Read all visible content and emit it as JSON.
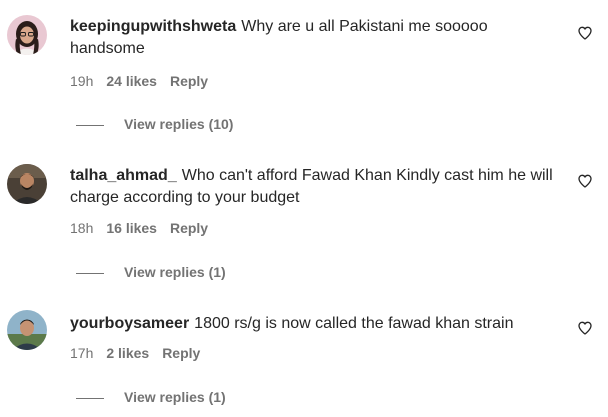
{
  "comments": [
    {
      "username": "keepingupwithshweta",
      "text": "Why are u all Pakistani me sooooo handsome",
      "time": "19h",
      "likes": "24 likes",
      "reply_label": "Reply",
      "view_replies": "View replies (10)",
      "avatar_icon": "avatar-woman-glasses"
    },
    {
      "username": "talha_ahmad_",
      "text": "Who can't afford Fawad Khan Kindly cast him he will charge according to your budget",
      "time": "18h",
      "likes": "16 likes",
      "reply_label": "Reply",
      "view_replies": "View replies (1)",
      "avatar_icon": "avatar-man-dark"
    },
    {
      "username": "yourboysameer",
      "text": "1800 rs/g is now called the fawad khan strain",
      "time": "17h",
      "likes": "2 likes",
      "reply_label": "Reply",
      "view_replies": "View replies (1)",
      "avatar_icon": "avatar-man-outdoor"
    }
  ],
  "icons": {
    "like": "heart-outline-icon"
  },
  "colors": {
    "text": "#262626",
    "secondary": "#737373",
    "background": "#ffffff"
  }
}
